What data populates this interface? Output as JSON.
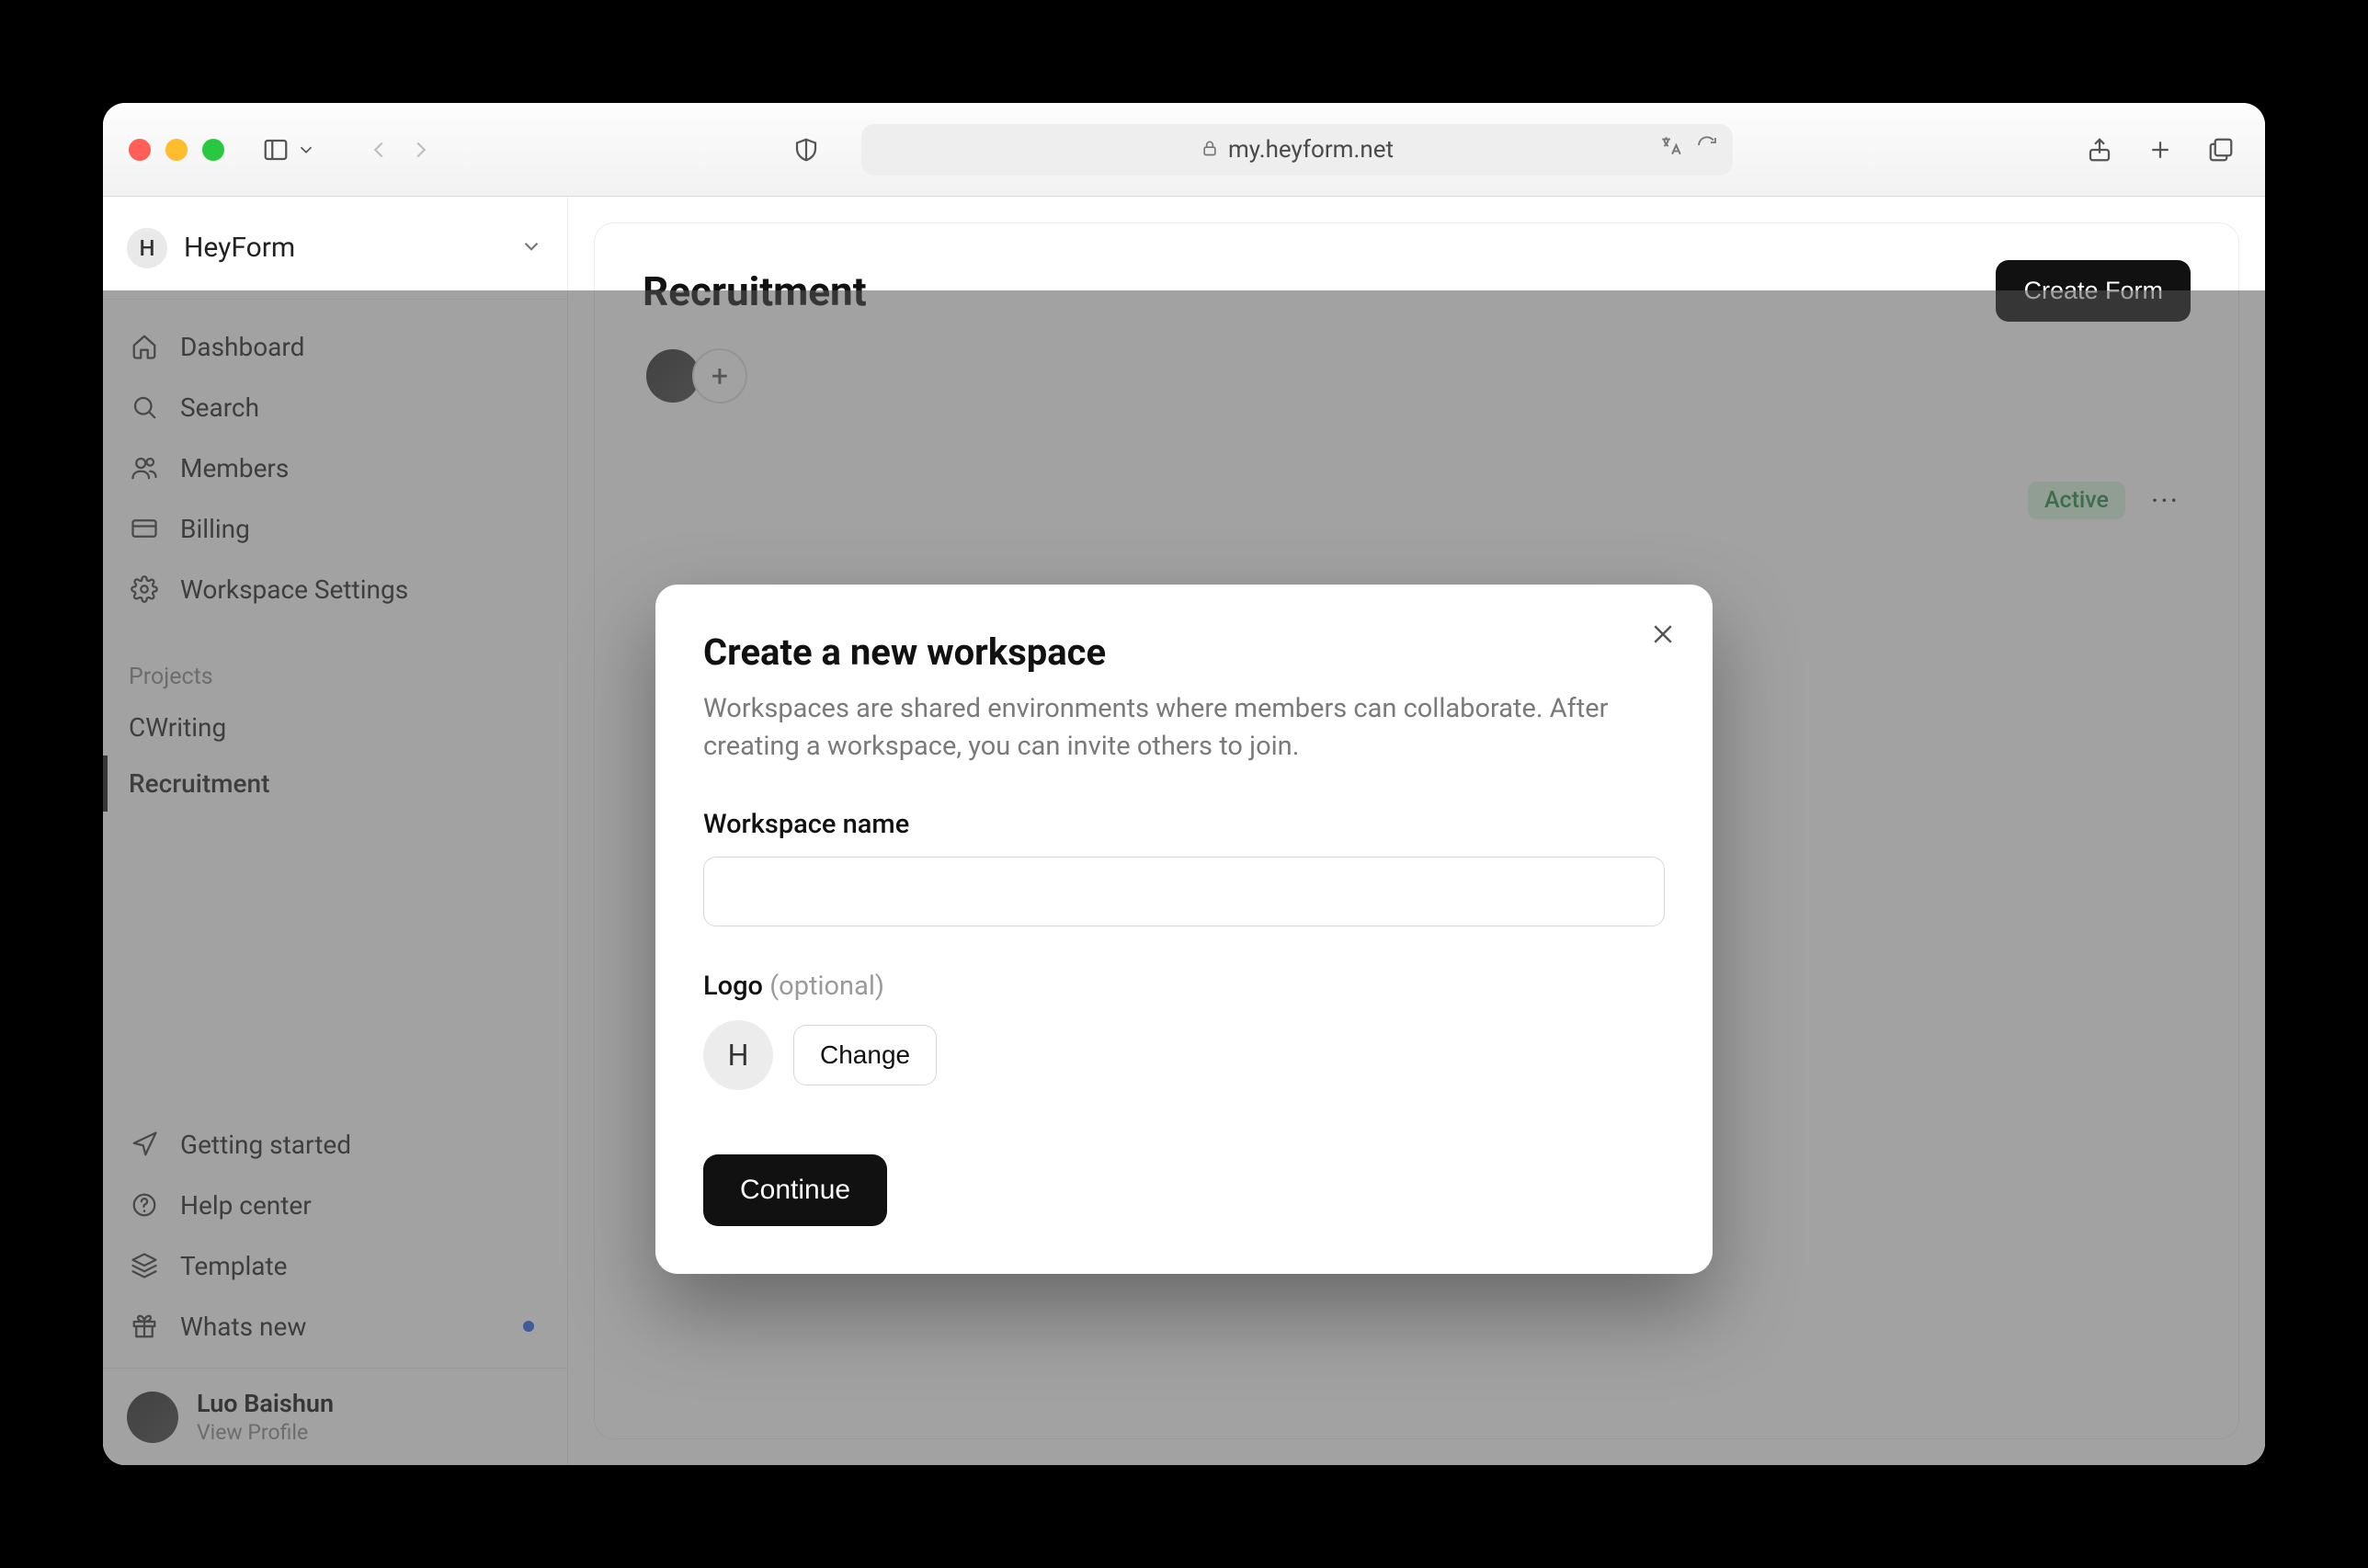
{
  "browser": {
    "url": "my.heyform.net"
  },
  "workspace": {
    "badge": "H",
    "name": "HeyForm"
  },
  "sidebar": {
    "dashboard": "Dashboard",
    "search": "Search",
    "members": "Members",
    "billing": "Billing",
    "settings": "Workspace Settings",
    "projects_label": "Projects",
    "projects": [
      {
        "name": "CWriting"
      },
      {
        "name": "Recruitment"
      }
    ],
    "getting_started": "Getting started",
    "help_center": "Help center",
    "template": "Template",
    "whats_new": "Whats new"
  },
  "profile": {
    "name": "Luo Baishun",
    "sub": "View Profile"
  },
  "page": {
    "title": "Recruitment",
    "create_form": "Create Form",
    "row_status": "Active"
  },
  "modal": {
    "title": "Create a new workspace",
    "description": "Workspaces are shared environments where members can collaborate. After creating a workspace, you can invite others to join.",
    "name_label": "Workspace name",
    "name_value": "",
    "logo_label": "Logo",
    "logo_optional": "(optional)",
    "logo_badge": "H",
    "change": "Change",
    "continue": "Continue"
  }
}
